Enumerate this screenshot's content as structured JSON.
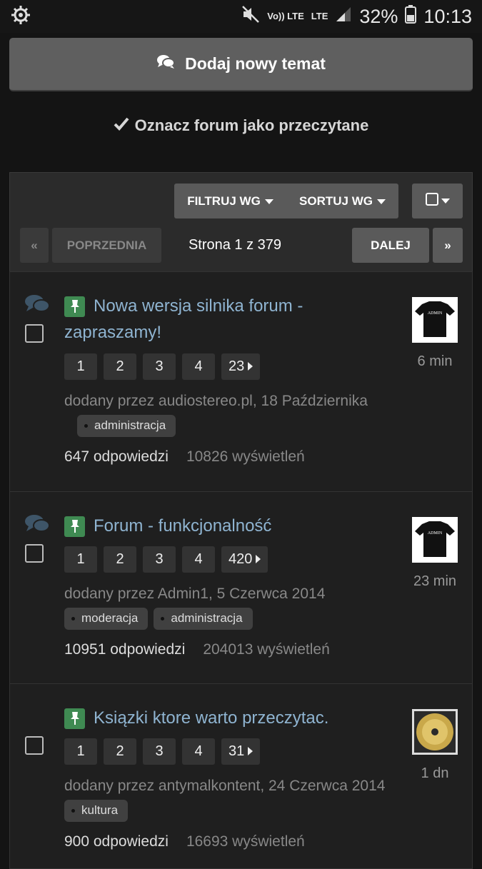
{
  "status": {
    "signal_text": "Vo)) LTE",
    "lte": "LTE",
    "battery": "32%",
    "time": "10:13"
  },
  "actions": {
    "new_topic": "Dodaj nowy temat",
    "mark_read": "Oznacz forum jako przeczytane"
  },
  "toolbar": {
    "filter": "FILTRUJ WG",
    "sort": "SORTUJ WG"
  },
  "pagination": {
    "first": "«",
    "prev": "POPRZEDNIA",
    "info": "Strona 1 z 379",
    "next": "DALEJ",
    "last": "»"
  },
  "topics": [
    {
      "title": "Nowa wersja silnika forum - zapraszamy!",
      "pages": [
        "1",
        "2",
        "3",
        "4",
        "23"
      ],
      "meta": "dodany przez audiostereo.pl, 18 Października",
      "tags": [
        "administracja"
      ],
      "replies": "647 odpowiedzi",
      "views": "10826 wyświetleń",
      "time": "6 min",
      "avatar": "ADMIN"
    },
    {
      "title": "Forum - funkcjonalność",
      "pages": [
        "1",
        "2",
        "3",
        "4",
        "420"
      ],
      "meta": "dodany przez Admin1, 5 Czerwca 2014",
      "tags": [
        "moderacja",
        "administracja"
      ],
      "replies": "10951 odpowiedzi",
      "views": "204013 wyświetleń",
      "time": "23 min",
      "avatar": "ADMIN"
    },
    {
      "title": "Ksiązki ktore warto przeczytac.",
      "pages": [
        "1",
        "2",
        "3",
        "4",
        "31"
      ],
      "meta": "dodany przez antymalkontent, 24 Czerwca 2014",
      "tags": [
        "kultura"
      ],
      "replies": "900 odpowiedzi",
      "views": "16693 wyświetleń",
      "time": "1 dn"
    }
  ],
  "colors": {
    "accent_link": "#8fb4d1",
    "pin": "#3f8a52"
  }
}
